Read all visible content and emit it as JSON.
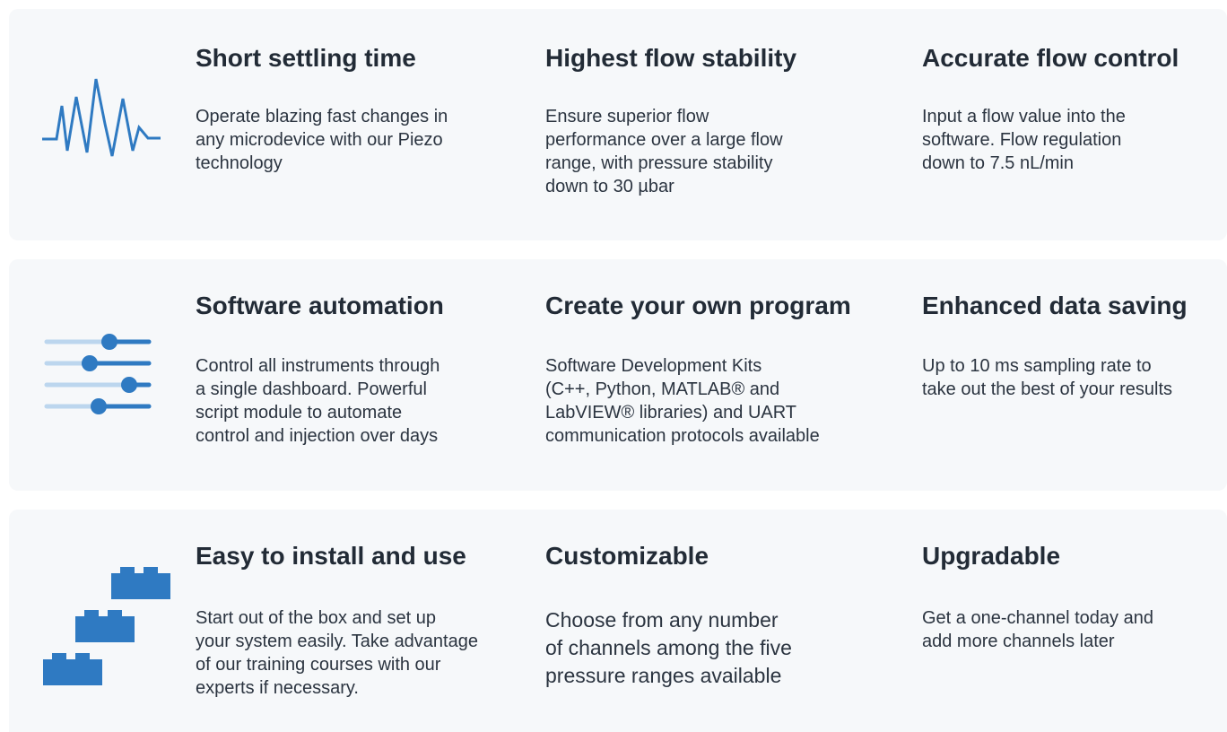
{
  "colors": {
    "card_background": "#f6f8fa",
    "heading": "#222b36",
    "body_text": "#2b3440",
    "icon_blue": "#2f7ac2",
    "icon_light_blue": "#bcd6ee"
  },
  "rows": [
    {
      "icon": "waveform-icon",
      "features": [
        {
          "title": "Short settling time",
          "description": "Operate blazing fast changes in\nany microdevice with our Piezo\ntechnology"
        },
        {
          "title": "Highest flow stability",
          "description": "Ensure superior flow\nperformance over a large flow\nrange, with pressure stability\ndown to 30 µbar"
        },
        {
          "title": "Accurate flow control",
          "description": "Input a flow value into the\nsoftware. Flow regulation\ndown to 7.5 nL/min"
        }
      ]
    },
    {
      "icon": "sliders-icon",
      "features": [
        {
          "title": "Software automation",
          "description": "Control all instruments through\na single dashboard. Powerful\nscript module to automate\ncontrol and injection over days"
        },
        {
          "title": "Create your own program",
          "description": "Software Development Kits\n(C++, Python, MATLAB® and\nLabVIEW® libraries) and UART\ncommunication protocols available"
        },
        {
          "title": "Enhanced data saving",
          "description": "Up to 10 ms sampling rate to\ntake out the best of your results"
        }
      ]
    },
    {
      "icon": "building-blocks-icon",
      "features": [
        {
          "title": "Easy to install and use",
          "description": "Start out of the box and set up\nyour system easily. Take advantage\nof our training courses with our\nexperts if necessary."
        },
        {
          "title": "Customizable",
          "description": "Choose from any number\nof channels among the five\npressure ranges available"
        },
        {
          "title": "Upgradable",
          "description": "Get a one-channel today and\nadd more channels later"
        }
      ]
    }
  ]
}
